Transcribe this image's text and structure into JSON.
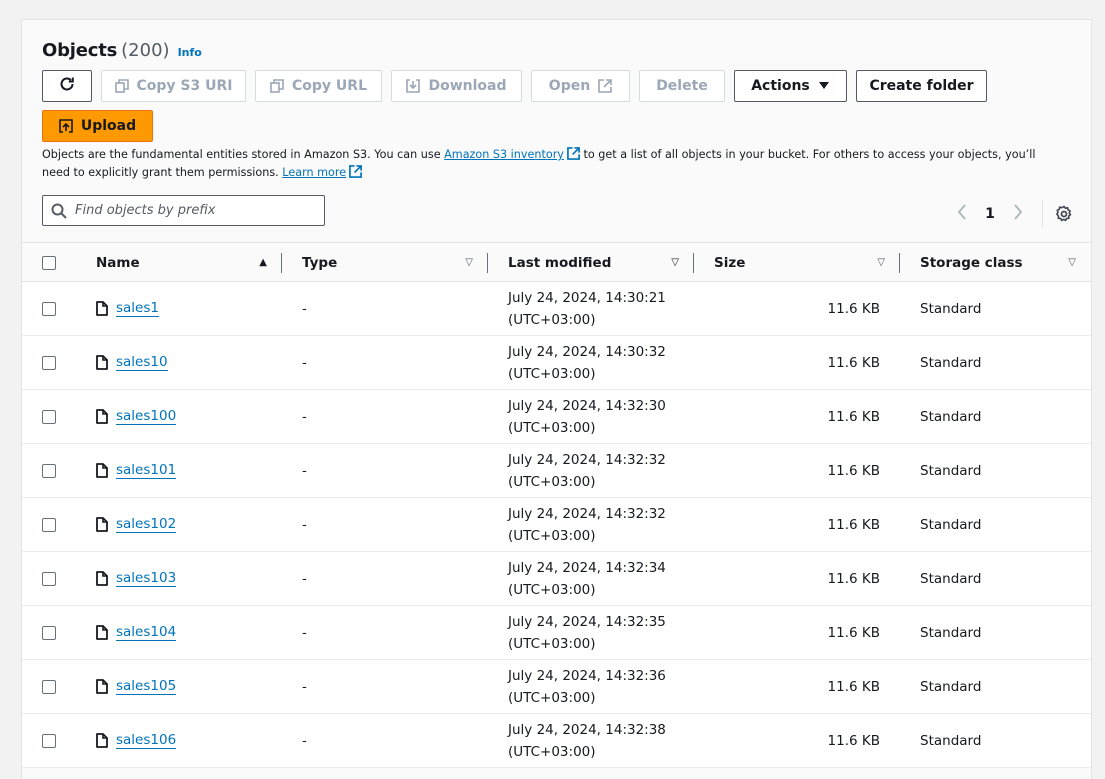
{
  "header": {
    "title": "Objects",
    "count": "(200)",
    "info_label": "Info"
  },
  "toolbar": {
    "refresh_icon": "refresh-icon",
    "copy_s3_uri": "Copy S3 URI",
    "copy_url": "Copy URL",
    "download": "Download",
    "open": "Open",
    "delete": "Delete",
    "actions": "Actions",
    "create_folder": "Create folder",
    "upload": "Upload"
  },
  "description": {
    "part1": "Objects are the fundamental entities stored in Amazon S3. You can use ",
    "link1": "Amazon S3 inventory",
    "part2": " to get a list of all objects in your bucket. For others to access your objects, you’ll need to explicitly grant them permissions. ",
    "link2": "Learn more"
  },
  "search": {
    "placeholder": "Find objects by prefix",
    "value": ""
  },
  "pagination": {
    "current_page": "1"
  },
  "table": {
    "columns": [
      "Name",
      "Type",
      "Last modified",
      "Size",
      "Storage class"
    ],
    "rows": [
      {
        "name": "sales1",
        "type": "-",
        "modified_date": "July 24, 2024, 14:30:21",
        "modified_tz": "(UTC+03:00)",
        "size": "11.6 KB",
        "storage_class": "Standard"
      },
      {
        "name": "sales10",
        "type": "-",
        "modified_date": "July 24, 2024, 14:30:32",
        "modified_tz": "(UTC+03:00)",
        "size": "11.6 KB",
        "storage_class": "Standard"
      },
      {
        "name": "sales100",
        "type": "-",
        "modified_date": "July 24, 2024, 14:32:30",
        "modified_tz": "(UTC+03:00)",
        "size": "11.6 KB",
        "storage_class": "Standard"
      },
      {
        "name": "sales101",
        "type": "-",
        "modified_date": "July 24, 2024, 14:32:32",
        "modified_tz": "(UTC+03:00)",
        "size": "11.6 KB",
        "storage_class": "Standard"
      },
      {
        "name": "sales102",
        "type": "-",
        "modified_date": "July 24, 2024, 14:32:32",
        "modified_tz": "(UTC+03:00)",
        "size": "11.6 KB",
        "storage_class": "Standard"
      },
      {
        "name": "sales103",
        "type": "-",
        "modified_date": "July 24, 2024, 14:32:34",
        "modified_tz": "(UTC+03:00)",
        "size": "11.6 KB",
        "storage_class": "Standard"
      },
      {
        "name": "sales104",
        "type": "-",
        "modified_date": "July 24, 2024, 14:32:35",
        "modified_tz": "(UTC+03:00)",
        "size": "11.6 KB",
        "storage_class": "Standard"
      },
      {
        "name": "sales105",
        "type": "-",
        "modified_date": "July 24, 2024, 14:32:36",
        "modified_tz": "(UTC+03:00)",
        "size": "11.6 KB",
        "storage_class": "Standard"
      },
      {
        "name": "sales106",
        "type": "-",
        "modified_date": "July 24, 2024, 14:32:38",
        "modified_tz": "(UTC+03:00)",
        "size": "11.6 KB",
        "storage_class": "Standard"
      }
    ]
  },
  "colors": {
    "accent": "#ff9900",
    "link": "#0073bb",
    "text": "#16191f",
    "disabled": "#9ba7b6"
  }
}
